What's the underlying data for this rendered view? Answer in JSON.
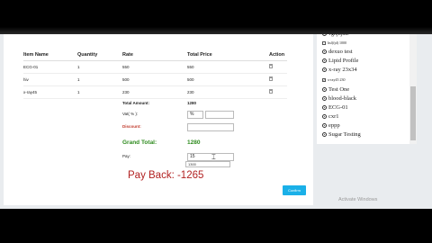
{
  "table": {
    "headers": [
      "Item Name",
      "Quantity",
      "Rate",
      "Total Price",
      "Action"
    ],
    "rows": [
      {
        "name": "ECG-01",
        "qty": "1",
        "rate": "550",
        "total": "550"
      },
      {
        "name": "hiv",
        "qty": "1",
        "rate": "500",
        "total": "500"
      },
      {
        "name": "x-ray45",
        "qty": "1",
        "rate": "230",
        "total": "230"
      }
    ]
  },
  "summary": {
    "total_amount_label": "Total Amount:",
    "total_amount_value": "1280",
    "vat_label": "Vat( % ):",
    "vat_value": "%",
    "discount_label": "Discount:",
    "grand_total_label": "Grand Total:",
    "grand_total_value": "1280",
    "pay_label": "Pay:",
    "pay_value": "15",
    "pay_suggestion": "1300"
  },
  "payback": "Pay Back: -1265",
  "confirm_label": "Confirm",
  "side_list": [
    {
      "kind": "radio",
      "label": "vghjhjhtc"
    },
    {
      "kind": "checkbox",
      "label": "hsf(fjd) 1000"
    },
    {
      "kind": "radio",
      "label": "dexuo test"
    },
    {
      "kind": "radio",
      "label": "Lipid Profile"
    },
    {
      "kind": "radio",
      "label": "x-ray 23x34"
    },
    {
      "kind": "checkbox",
      "label": "x-ray45 230"
    },
    {
      "kind": "radio",
      "label": "Test One"
    },
    {
      "kind": "radio",
      "label": "blood-black"
    },
    {
      "kind": "radio",
      "label": "ECG-01"
    },
    {
      "kind": "radio",
      "label": "cxr1"
    },
    {
      "kind": "radio",
      "label": "eppp"
    },
    {
      "kind": "radio",
      "label": "Sugar Testing"
    }
  ],
  "watermark": "Activate Windows"
}
